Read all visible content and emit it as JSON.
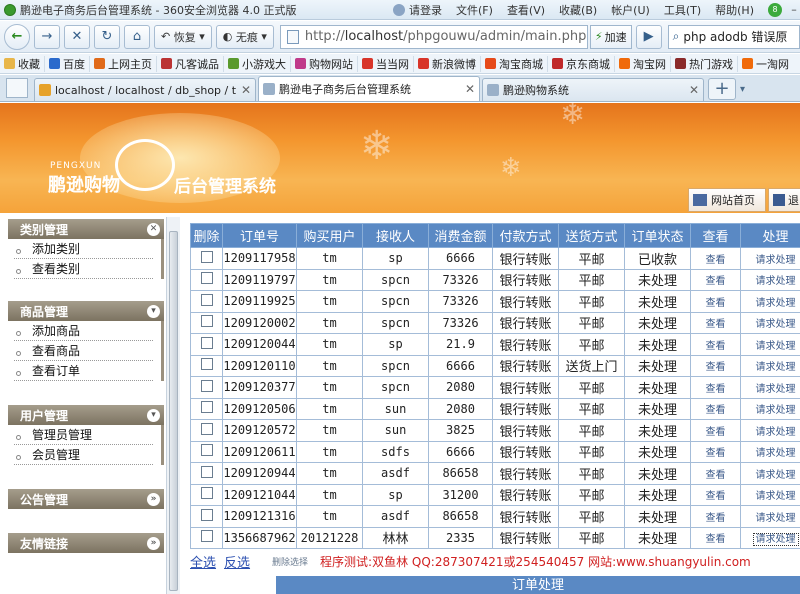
{
  "window": {
    "title": "鹏逊电子商务后台管理系统 - 360安全浏览器 4.0 正式版",
    "login": "请登录",
    "menu": [
      "文件(F)",
      "查看(V)",
      "收藏(B)",
      "帐户(U)",
      "工具(T)",
      "帮助(H)"
    ],
    "badge": "8"
  },
  "nav": {
    "restore_label": "恢复",
    "noTrace_label": "无痕",
    "url_prefix": "http://",
    "url_host": "localhost",
    "url_path": "/phpgouwu/admin/main.php",
    "speed_label": "加速",
    "search_text": "php adodb 错误原"
  },
  "bookmarks": [
    {
      "label": "收藏",
      "color": "#e8b64a"
    },
    {
      "label": "百度",
      "color": "#2b6acc"
    },
    {
      "label": "上网主页",
      "color": "#e06a1a"
    },
    {
      "label": "凡客诚品",
      "color": "#b33"
    },
    {
      "label": "小游戏大",
      "color": "#5a9a2e"
    },
    {
      "label": "购物网站",
      "color": "#c03a8a"
    },
    {
      "label": "当当网",
      "color": "#d8352a"
    },
    {
      "label": "新浪微博",
      "color": "#d8352a"
    },
    {
      "label": "淘宝商城",
      "color": "#e64a1a"
    },
    {
      "label": "京东商城",
      "color": "#c0292a"
    },
    {
      "label": "淘宝网",
      "color": "#f06a0a"
    },
    {
      "label": "热门游戏",
      "color": "#8a2a2a"
    },
    {
      "label": "一淘网",
      "color": "#f06a0a"
    }
  ],
  "tabs": [
    {
      "label": "localhost / localhost / db_shop / t...",
      "active": false
    },
    {
      "label": "鹏逊电子商务后台管理系统",
      "active": true
    },
    {
      "label": "鹏逊购物系统",
      "active": false
    }
  ],
  "banner": {
    "brand_small": "PENGXUN",
    "brand": "鹏逊购物",
    "subtitle": "后台管理系统",
    "home_label": "网站首页",
    "back_label": "退"
  },
  "sidebar": {
    "sections": [
      {
        "title": "类别管理",
        "items": [
          "添加类别",
          "查看类别"
        ]
      },
      {
        "title": "商品管理",
        "items": [
          "添加商品",
          "查看商品",
          "查看订单"
        ]
      },
      {
        "title": "用户管理",
        "items": [
          "管理员管理",
          "会员管理"
        ]
      },
      {
        "title": "公告管理",
        "items": []
      },
      {
        "title": "友情链接",
        "items": []
      }
    ]
  },
  "table": {
    "headers": [
      "删除",
      "订单号",
      "购买用户",
      "接收人",
      "消费金额",
      "付款方式",
      "送货方式",
      "订单状态",
      "查看",
      "处理"
    ],
    "view_label": "查看",
    "handle_label": "请求处理",
    "rows": [
      [
        "1209117958",
        "tm",
        "sp",
        "6666",
        "银行转账",
        "平邮",
        "已收款"
      ],
      [
        "1209119797",
        "tm",
        "spcn",
        "73326",
        "银行转账",
        "平邮",
        "未处理"
      ],
      [
        "1209119925",
        "tm",
        "spcn",
        "73326",
        "银行转账",
        "平邮",
        "未处理"
      ],
      [
        "1209120002",
        "tm",
        "spcn",
        "73326",
        "银行转账",
        "平邮",
        "未处理"
      ],
      [
        "1209120044",
        "tm",
        "sp",
        "21.9",
        "银行转账",
        "平邮",
        "未处理"
      ],
      [
        "1209120110",
        "tm",
        "spcn",
        "6666",
        "银行转账",
        "送货上门",
        "未处理"
      ],
      [
        "1209120377",
        "tm",
        "spcn",
        "2080",
        "银行转账",
        "平邮",
        "未处理"
      ],
      [
        "1209120506",
        "tm",
        "sun",
        "2080",
        "银行转账",
        "平邮",
        "未处理"
      ],
      [
        "1209120572",
        "tm",
        "sun",
        "3825",
        "银行转账",
        "平邮",
        "未处理"
      ],
      [
        "1209120611",
        "tm",
        "sdfs",
        "6666",
        "银行转账",
        "平邮",
        "未处理"
      ],
      [
        "1209120944",
        "tm",
        "asdf",
        "86658",
        "银行转账",
        "平邮",
        "未处理"
      ],
      [
        "1209121044",
        "tm",
        "sp",
        "31200",
        "银行转账",
        "平邮",
        "未处理"
      ],
      [
        "1209121316",
        "tm",
        "asdf",
        "86658",
        "银行转账",
        "平邮",
        "未处理"
      ],
      [
        "1356687962",
        "20121228",
        "林林",
        "2335",
        "银行转账",
        "平邮",
        "未处理"
      ]
    ]
  },
  "footer": {
    "select_all": "全选",
    "invert": "反选",
    "delete_selected": "删除选择",
    "info": "程序测试:双鱼林 QQ:287307421或254540457 网站:www.shuangyulin.com"
  },
  "bottom_title": "订单处理"
}
